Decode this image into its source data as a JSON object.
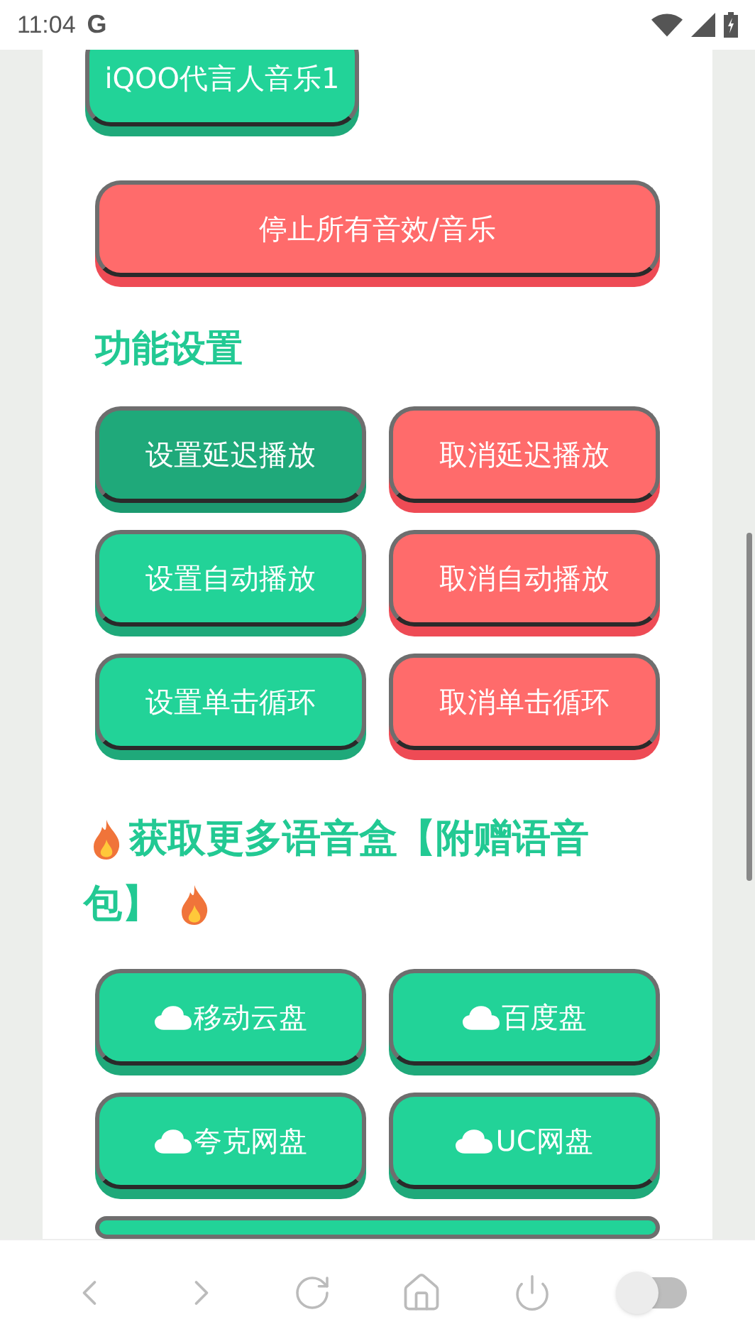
{
  "status_bar": {
    "time": "11:04",
    "network": "G"
  },
  "top_button": {
    "label": "iQOO代言人音乐1",
    "kind": "green"
  },
  "stop_button": {
    "label": "停止所有音效/音乐",
    "kind": "red"
  },
  "settings": {
    "title": "功能设置",
    "buttons": [
      {
        "label": "设置延迟播放",
        "kind": "green",
        "selected": true
      },
      {
        "label": "取消延迟播放",
        "kind": "red",
        "selected": false
      },
      {
        "label": "设置自动播放",
        "kind": "green",
        "selected": false
      },
      {
        "label": "取消自动播放",
        "kind": "red",
        "selected": false
      },
      {
        "label": "设置单击循环",
        "kind": "green",
        "selected": false
      },
      {
        "label": "取消单击循环",
        "kind": "red",
        "selected": false
      }
    ]
  },
  "more": {
    "title_lines": [
      "获取更多语音盒【附赠语音",
      "包】"
    ],
    "buttons": [
      {
        "label": "移动云盘",
        "kind": "cloud"
      },
      {
        "label": "百度盘",
        "kind": "cloud"
      },
      {
        "label": "夸克网盘",
        "kind": "cloud"
      },
      {
        "label": "UC网盘",
        "kind": "cloud"
      }
    ]
  },
  "nav": {
    "toggle": {
      "on": false
    }
  }
}
